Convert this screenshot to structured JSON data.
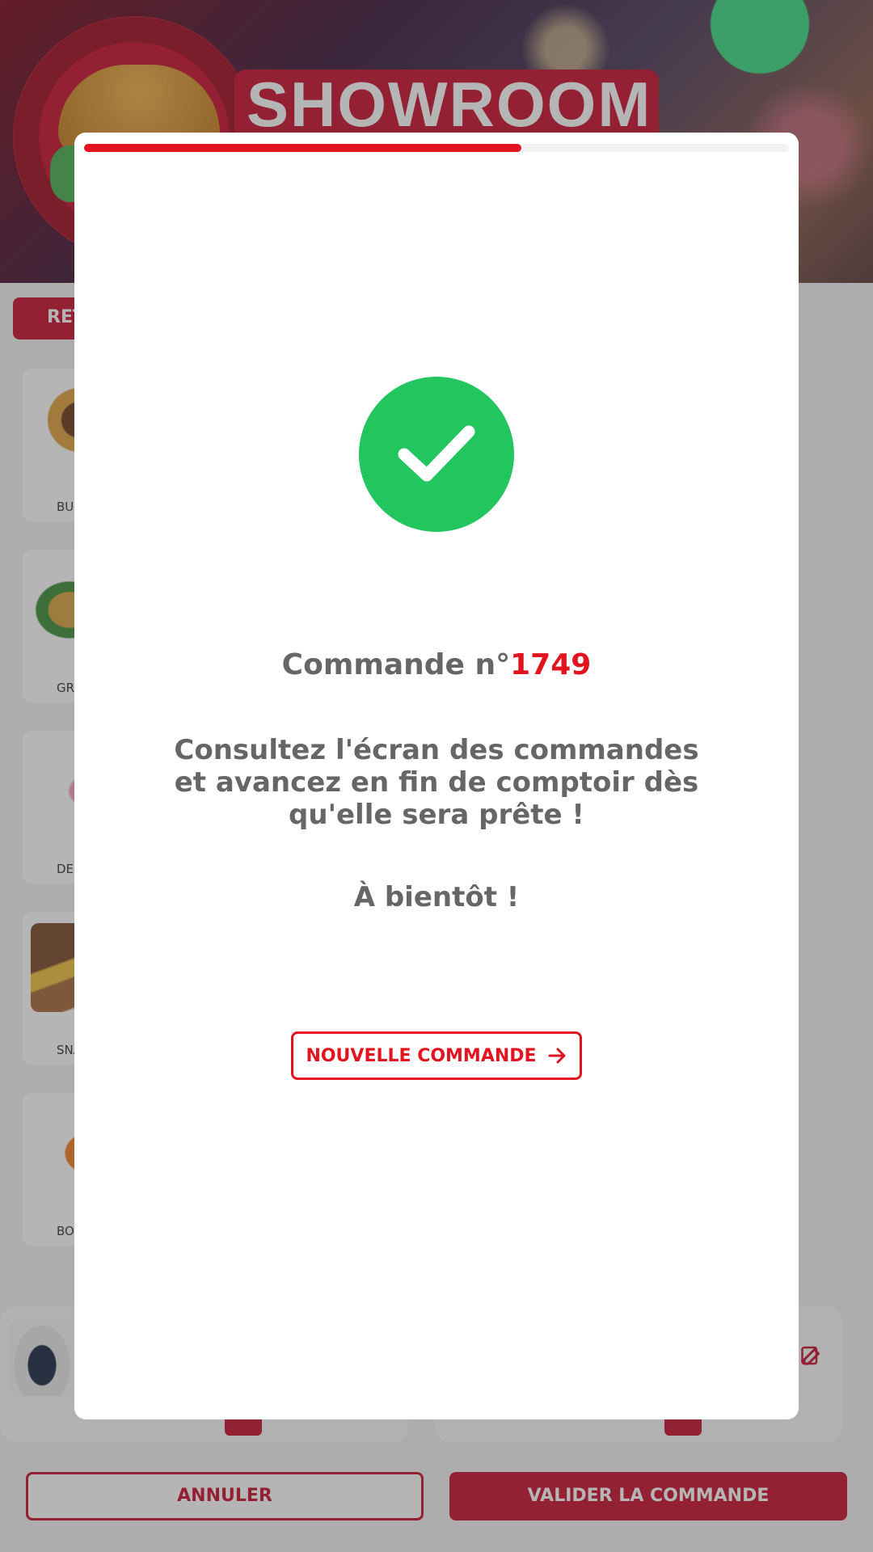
{
  "brand": {
    "name": "SHOWROOM"
  },
  "nav": {
    "back_label": "RET"
  },
  "categories": [
    {
      "label": "BU"
    },
    {
      "label": "GRI"
    },
    {
      "label": "DES"
    },
    {
      "label": "SNA"
    },
    {
      "label": "BOI"
    }
  ],
  "footer": {
    "cancel_label": "ANNULER",
    "confirm_label": "VALIDER LA COMMANDE"
  },
  "modal": {
    "progress_fraction": 0.62,
    "order_prefix": "Commande n°",
    "order_number": "1749",
    "message": "Consultez l'écran des commandes et avancez en fin de comptoir dès qu'elle sera prête !",
    "farewell": "À bientôt !",
    "new_order_label": "NOUVELLE COMMANDE",
    "success_icon": "check-circle-icon",
    "button_icon": "arrow-right-icon"
  },
  "colors": {
    "accent": "#e1141f",
    "success": "#22c55e",
    "text": "#666666"
  }
}
